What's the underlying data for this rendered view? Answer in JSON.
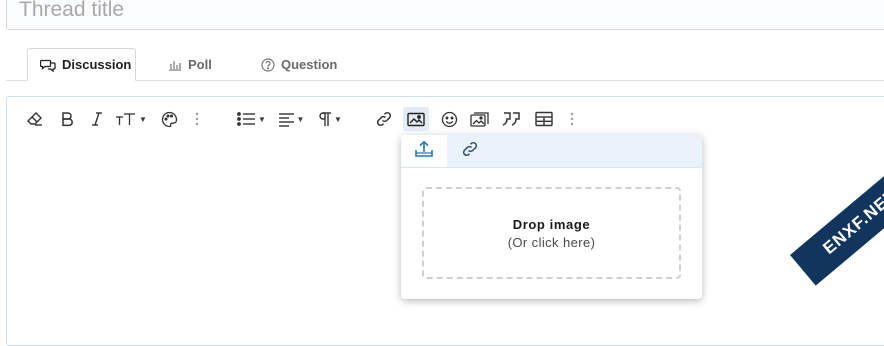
{
  "title_input": {
    "placeholder": "Thread title"
  },
  "tabs": [
    {
      "label": "Discussion",
      "icon": "chat-bubbles-icon",
      "active": true
    },
    {
      "label": "Poll",
      "icon": "bar-chart-icon",
      "active": false
    },
    {
      "label": "Question",
      "icon": "question-circle-icon",
      "active": false
    }
  ],
  "toolbar": {
    "icons": [
      "eraser-icon",
      "bold-icon",
      "italic-icon",
      "text-size-icon",
      "palette-icon",
      "more-vertical-icon",
      "list-icon",
      "align-icon",
      "paragraph-icon",
      "link-icon",
      "image-icon",
      "smiley-icon",
      "media-icon",
      "quote-icon",
      "table-icon",
      "more-vertical-icon"
    ],
    "active_button": "image-icon"
  },
  "image_popup": {
    "tabs": [
      "upload-icon",
      "link-icon"
    ],
    "drop_title": "Drop image",
    "drop_subtitle": "(Or click here)"
  },
  "watermark": {
    "text": "ENXF.NET"
  },
  "colors": {
    "accent": "#2577b1",
    "tab_strip": "#eaf3fb",
    "border": "#d8d8d8"
  }
}
